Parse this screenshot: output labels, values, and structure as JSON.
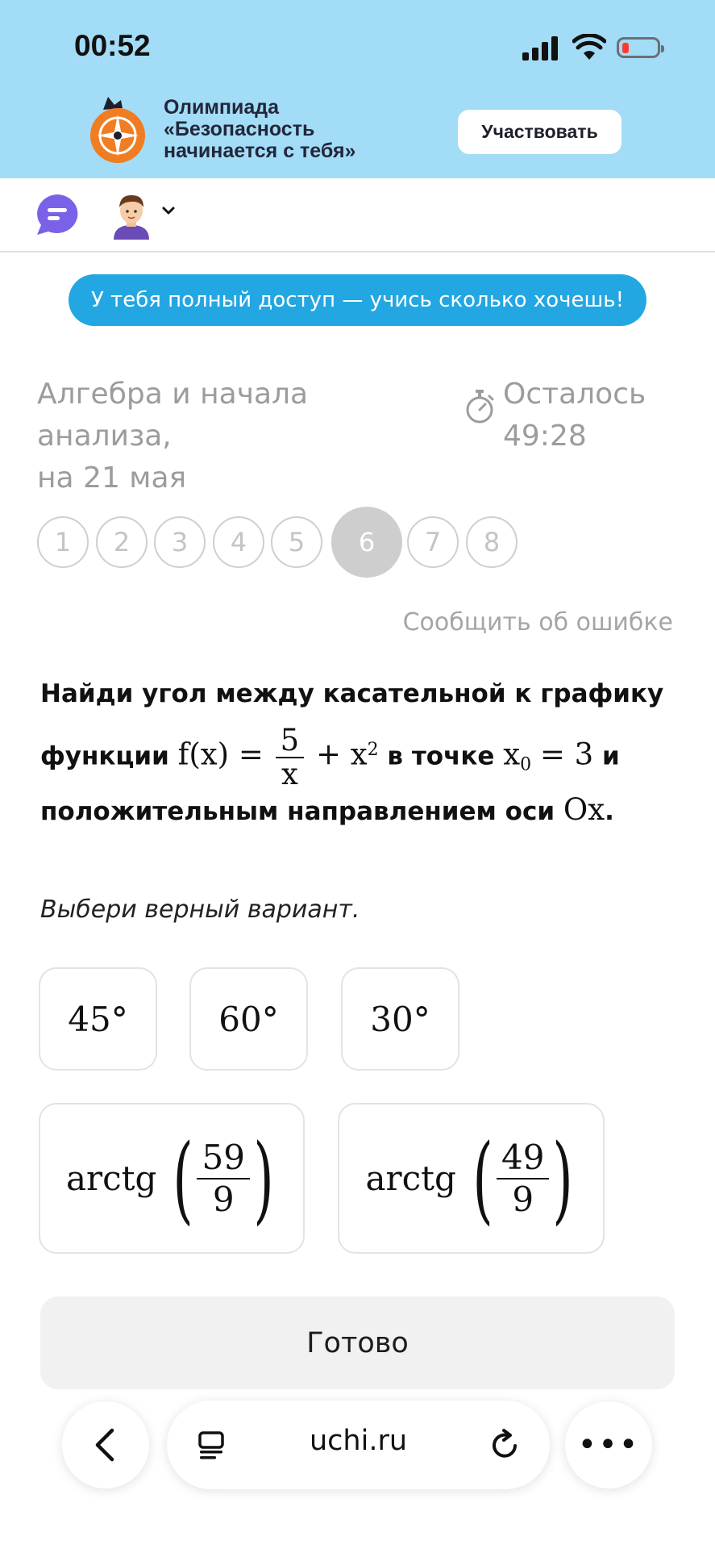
{
  "status_bar": {
    "time": "00:52"
  },
  "banner": {
    "title_lines": [
      "Олимпиада",
      "«Безопасность",
      "начинается с тебя»"
    ],
    "button_label": "Участвовать"
  },
  "access_message": "У тебя полный доступ — учись сколько хочешь!",
  "lesson": {
    "subject_line1": "Алгебра и начала анализа,",
    "subject_line2": "на 21 мая",
    "timer_label": "Осталось",
    "timer_value": "49:28"
  },
  "task_nav": {
    "items": [
      "1",
      "2",
      "3",
      "4",
      "5",
      "6",
      "7",
      "8"
    ],
    "active": "6"
  },
  "report_error": "Сообщить об ошибке",
  "question": {
    "line1": "Найди угол между касательной к графику",
    "part_functions": "функции",
    "f_prefix": "f(x) =",
    "frac_num": "5",
    "frac_den": "x",
    "plus_term": "+ x",
    "exp": "2",
    "in_point": "в точке",
    "x0": "x",
    "x0_sub": "0",
    "x0_value": "= 3",
    "and": "и",
    "line3_text": "положительным направлением оси",
    "axis": "Ox",
    "period": "."
  },
  "hint": "Выбери верный вариант.",
  "options": [
    {
      "label": "45°"
    },
    {
      "label": "60°"
    },
    {
      "label": "30°"
    },
    {
      "func": "arctg",
      "num": "59",
      "den": "9"
    },
    {
      "func": "arctg",
      "num": "49",
      "den": "9"
    }
  ],
  "done_button": "Готово",
  "browser": {
    "url": "uchi.ru",
    "more": "•••"
  },
  "colors": {
    "banner_bg": "#a3dcf6",
    "access_pill": "#23a7e2",
    "chat_icon": "#7b61e8",
    "logo_orange": "#f07d22",
    "muted_text": "#9c9c9c"
  }
}
